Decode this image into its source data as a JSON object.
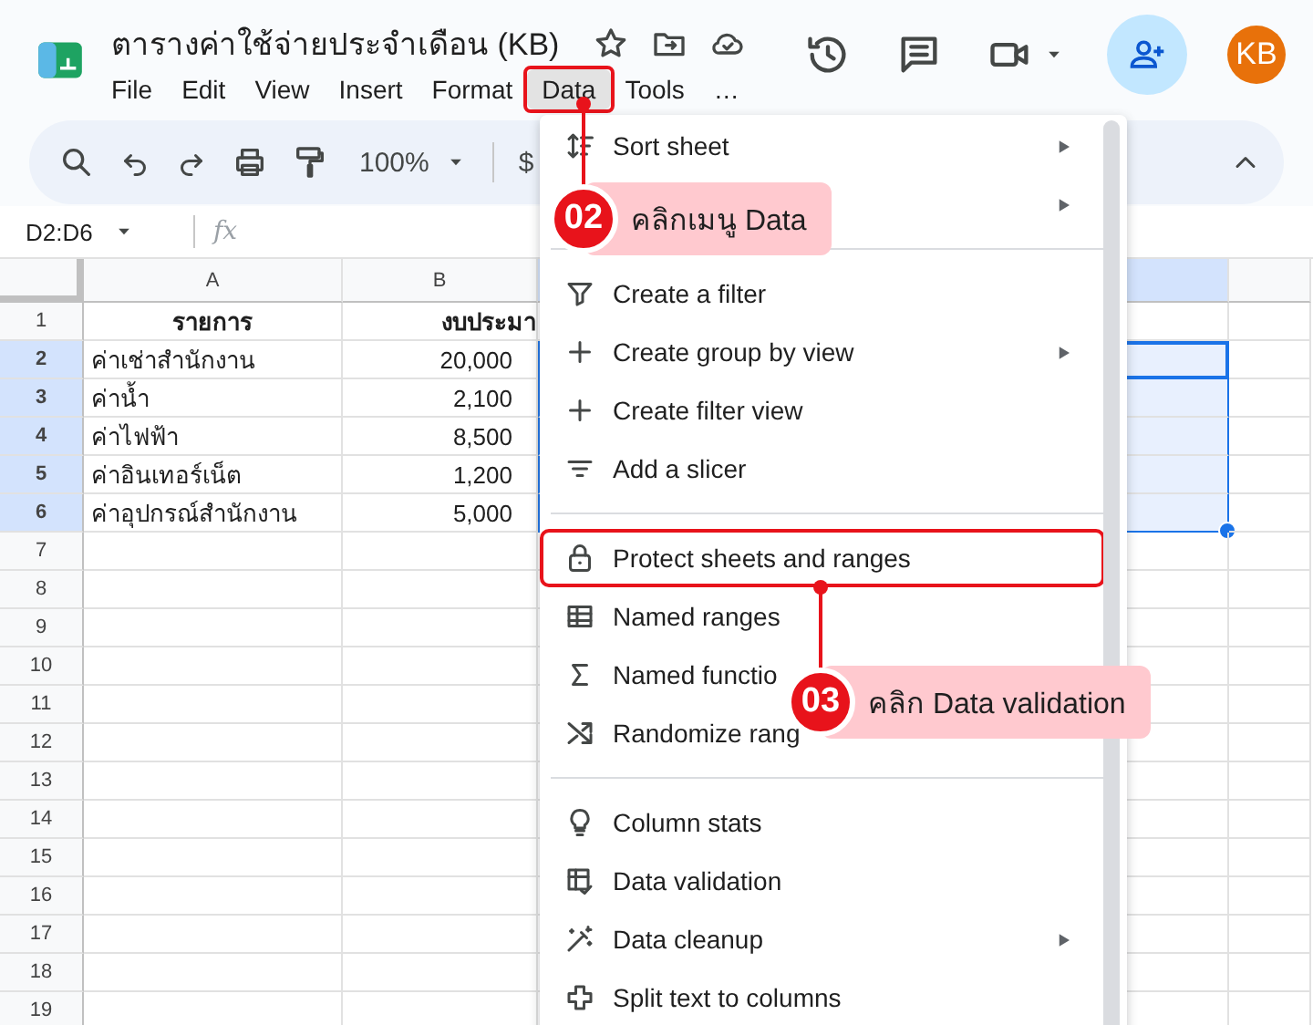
{
  "document": {
    "title": "ตารางค่าใช้จ่ายประจำเดือน (KB)",
    "avatar": "KB"
  },
  "menu_bar": [
    {
      "label": "File",
      "selected": false,
      "annotated": false
    },
    {
      "label": "Edit",
      "selected": false,
      "annotated": false
    },
    {
      "label": "View",
      "selected": false,
      "annotated": false
    },
    {
      "label": "Insert",
      "selected": false,
      "annotated": false
    },
    {
      "label": "Format",
      "selected": false,
      "annotated": false
    },
    {
      "label": "Data",
      "selected": true,
      "annotated": true
    },
    {
      "label": "Tools",
      "selected": false,
      "annotated": false
    },
    {
      "label": "…",
      "selected": false,
      "annotated": false
    }
  ],
  "toolbar": {
    "zoom": "100%",
    "currency": "$"
  },
  "formula_bar": {
    "name_box": "D2:D6",
    "fx": "fx"
  },
  "sheet": {
    "columns": [
      {
        "label": "A",
        "selected": false
      },
      {
        "label": "B",
        "selected": false
      },
      {
        "selected": true
      },
      {
        "selected": false
      }
    ],
    "rows": [
      {
        "number": "1",
        "selected": false,
        "cells": [
          "รายการ",
          "งบประมา"
        ]
      },
      {
        "number": "2",
        "selected": true,
        "cells": [
          "ค่าเช่าสำนักงาน",
          "20,000"
        ]
      },
      {
        "number": "3",
        "selected": true,
        "cells": [
          "ค่าน้ำ",
          "2,100"
        ]
      },
      {
        "number": "4",
        "selected": true,
        "cells": [
          "ค่าไฟฟ้า",
          "8,500"
        ]
      },
      {
        "number": "5",
        "selected": true,
        "cells": [
          "ค่าอินเทอร์เน็ต",
          "1,200"
        ]
      },
      {
        "number": "6",
        "selected": true,
        "cells": [
          "ค่าอุปกรณ์สำนักงาน",
          "5,000"
        ]
      },
      {
        "number": "7",
        "selected": false,
        "cells": []
      },
      {
        "number": "8",
        "selected": false,
        "cells": []
      },
      {
        "number": "9",
        "selected": false,
        "cells": []
      },
      {
        "number": "10",
        "selected": false,
        "cells": []
      },
      {
        "number": "11",
        "selected": false,
        "cells": []
      },
      {
        "number": "12",
        "selected": false,
        "cells": []
      },
      {
        "number": "13",
        "selected": false,
        "cells": []
      },
      {
        "number": "14",
        "selected": false,
        "cells": []
      },
      {
        "number": "15",
        "selected": false,
        "cells": []
      },
      {
        "number": "16",
        "selected": false,
        "cells": []
      },
      {
        "number": "17",
        "selected": false,
        "cells": []
      },
      {
        "number": "18",
        "selected": false,
        "cells": []
      },
      {
        "number": "19",
        "selected": false,
        "cells": []
      }
    ]
  },
  "data_menu": {
    "items": [
      {
        "kind": "item",
        "label": "Sort sheet",
        "submenu": true,
        "annotated": false
      },
      {
        "kind": "item",
        "submenu": true,
        "annotated": false
      },
      {
        "kind": "divider"
      },
      {
        "kind": "item",
        "label": "Create a filter",
        "submenu": false,
        "annotated": false
      },
      {
        "kind": "item",
        "label": "Create group by view",
        "submenu": true,
        "annotated": false
      },
      {
        "kind": "item",
        "label": "Create filter view",
        "submenu": false,
        "annotated": false
      },
      {
        "kind": "item",
        "label": "Add a slicer",
        "submenu": false,
        "annotated": false
      },
      {
        "kind": "divider"
      },
      {
        "kind": "item",
        "label": "Protect sheets and ranges",
        "submenu": false,
        "annotated": true
      },
      {
        "kind": "item",
        "label": "Named ranges",
        "submenu": false,
        "annotated": false
      },
      {
        "kind": "item",
        "label": "Named functio",
        "submenu": false,
        "annotated": false
      },
      {
        "kind": "item",
        "label": "Randomize rang",
        "submenu": false,
        "annotated": false
      },
      {
        "kind": "divider"
      },
      {
        "kind": "item",
        "label": "Column stats",
        "submenu": false,
        "annotated": false
      },
      {
        "kind": "item",
        "label": "Data validation",
        "submenu": false,
        "annotated": false
      },
      {
        "kind": "item",
        "label": "Data cleanup",
        "submenu": true,
        "annotated": false
      },
      {
        "kind": "item",
        "label": "Split text to columns",
        "submenu": false,
        "annotated": false
      }
    ]
  },
  "callouts": [
    {
      "step": "02",
      "text": "คลิกเมนู Data"
    },
    {
      "step": "03",
      "text": "คลิก Data validation"
    }
  ]
}
